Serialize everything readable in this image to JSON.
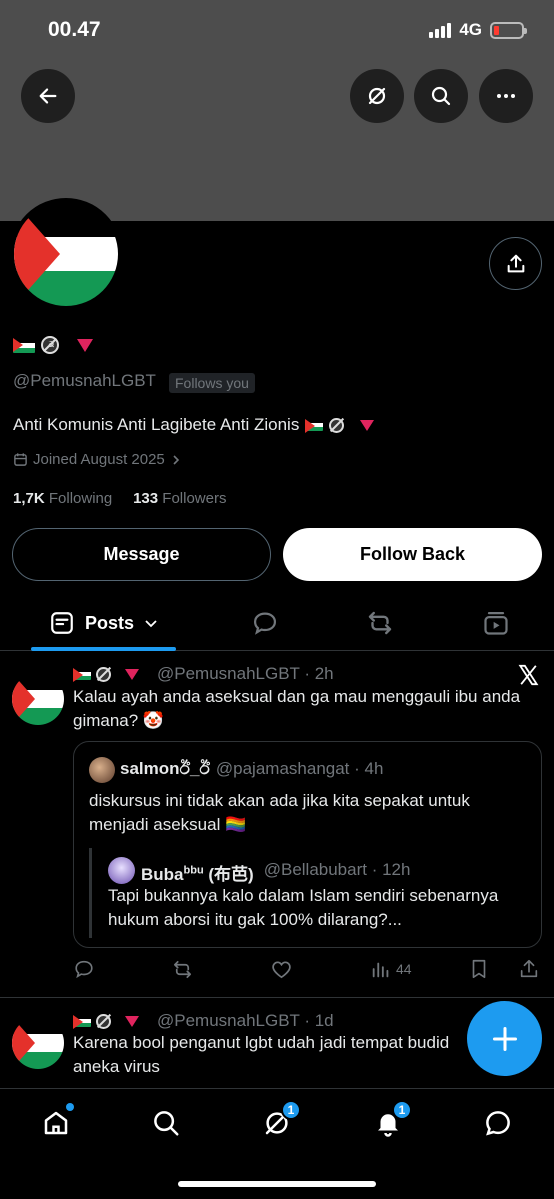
{
  "status_bar": {
    "time": "00.47",
    "network": "4G"
  },
  "header": {
    "back_icon": "arrow-left-icon",
    "grok_icon": "grok-icon",
    "search_icon": "search-icon",
    "more_icon": "more-icon"
  },
  "profile": {
    "handle": "@PemusnahLGBT",
    "follows_you": "Follows you",
    "bio": "Anti Komunis Anti Lagibete Anti Zionis",
    "joined": "Joined August 2025",
    "following_count": "1,7K",
    "following_label": "Following",
    "followers_count": "133",
    "followers_label": "Followers",
    "message_label": "Message",
    "follow_back_label": "Follow Back"
  },
  "tabs": {
    "posts_label": "Posts"
  },
  "posts": [
    {
      "handle_time": "@PemusnahLGBT · 2h",
      "text": "Kalau ayah anda aseksual dan ga mau menggauli ibu anda gimana? 🤡",
      "quote": {
        "author": "salmonඊ_ඊ",
        "handle_time": "@pajamashangat · 4h",
        "text": "diskursus ini tidak akan ada jika kita sepakat untuk menjadi aseksual 🏳️‍🌈",
        "inner": {
          "author": "Buba",
          "author_sup": "bbu",
          "author_suffix": " (布芭)",
          "handle_time": "@Bellabubart · 12h",
          "text": "Tapi bukannya kalo dalam Islam sendiri sebenarnya hukum aborsi itu gak 100% dilarang?..."
        }
      },
      "views": "44"
    },
    {
      "handle_time": "@PemusnahLGBT · 1d",
      "text": "Karena bool penganut lgbt udah jadi tempat budid aneka virus"
    }
  ],
  "bottom_nav": {
    "messages_badge": "1",
    "notifications_badge": "1"
  },
  "colors": {
    "accent": "#1d9bf0",
    "muted": "#71767b",
    "border": "#2f3336",
    "palestine_red": "#e4312b",
    "palestine_green": "#149954"
  }
}
